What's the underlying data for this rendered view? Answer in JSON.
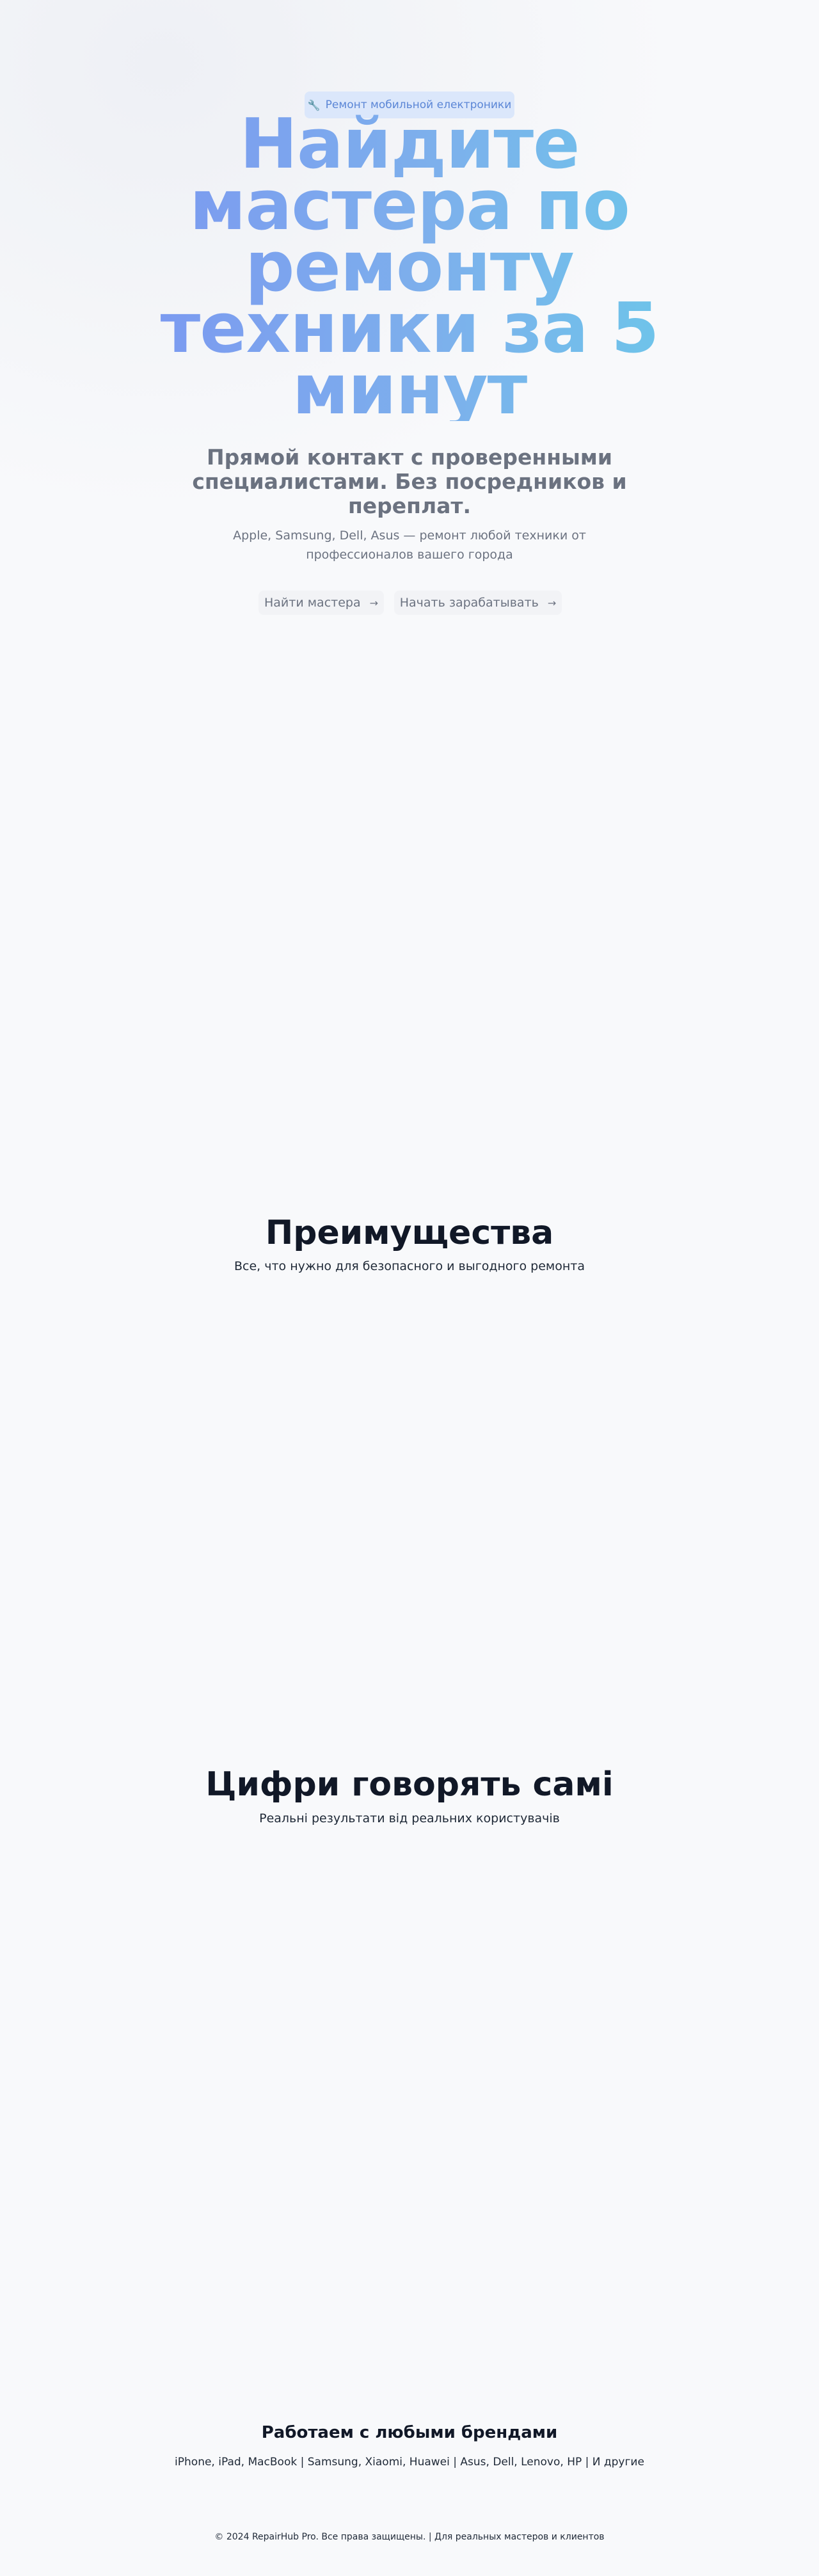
{
  "hero": {
    "badge_icon": "wrench-icon",
    "badge_label": "Ремонт мобильной електроники",
    "title": "Найдите мастера по ремонту техники за 5 минут",
    "subtitle": "Прямой контакт с проверенными специалистами. Без посредников и переплат.",
    "description": "Apple, Samsung, Dell, Asus — ремонт любой техники от профессионалов вашего города",
    "buttons": {
      "find_label": "Найти мастера",
      "earn_label": "Начать зарабатывать",
      "arrow": "→"
    },
    "colors": {
      "title_gradient_start": "#7b9af0",
      "title_gradient_end": "#6ec4ea",
      "badge_bg": "#dbe7fb",
      "badge_text": "#5b86d6"
    }
  },
  "advantages": {
    "title": "Преимущества",
    "subtitle": "Все, что нужно для безопасного и выгодного ремонта"
  },
  "numbers": {
    "title": "Цифри говорять самі",
    "subtitle": "Реальні результати від реальних користувачів"
  },
  "brands": {
    "title": "Работаем с любыми брендами",
    "list": "iPhone, iPad, MacBook | Samsung, Xiaomi, Huawei | Asus, Dell, Lenovo, HP | И другие"
  },
  "footer": {
    "text": "© 2024 RepairHub Pro. Все права защищены. | Для реальных мастеров и клиентов"
  }
}
